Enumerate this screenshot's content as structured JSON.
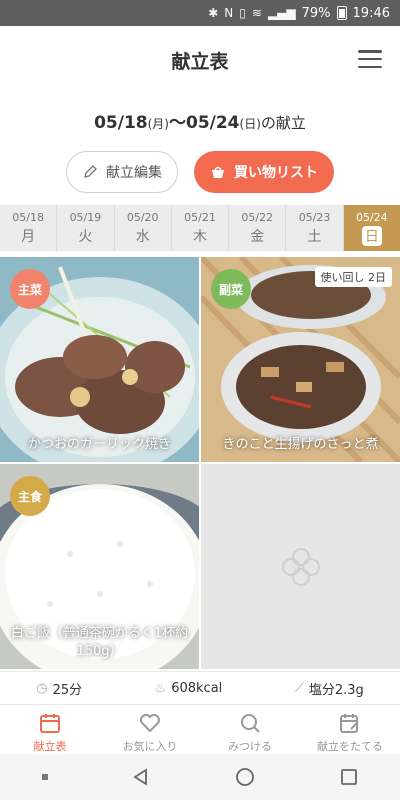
{
  "status": {
    "battery": "79%",
    "time": "19:46"
  },
  "header": {
    "title": "献立表"
  },
  "week": {
    "start": "05/18",
    "start_day": "(月)",
    "sep": "〜",
    "end": "05/24",
    "end_day": "(日)",
    "suffix": "の献立"
  },
  "actions": {
    "edit_label": "献立編集",
    "shopping_label": "買い物リスト"
  },
  "days": [
    {
      "date": "05/18",
      "weekday": "月"
    },
    {
      "date": "05/19",
      "weekday": "火"
    },
    {
      "date": "05/20",
      "weekday": "水"
    },
    {
      "date": "05/21",
      "weekday": "木"
    },
    {
      "date": "05/22",
      "weekday": "金"
    },
    {
      "date": "05/23",
      "weekday": "土"
    },
    {
      "date": "05/24",
      "weekday": "日"
    }
  ],
  "recipes": [
    {
      "tag": "主菜",
      "name": "かつおのガーリック焼き",
      "tag_color": "#f0836b"
    },
    {
      "tag": "副菜",
      "name": "きのこと生揚げのさっと煮",
      "badge": "使い回し 2日",
      "tag_color": "#7fba5a"
    },
    {
      "tag": "主食",
      "name": "白ご飯（普通茶碗かるく1杯約150g）",
      "tag_color": "#d4a94a"
    }
  ],
  "summary": {
    "time": "25分",
    "calories": "608kcal",
    "salt": "塩分2.3g"
  },
  "nav": {
    "menu": "献立表",
    "favorites": "お気に入り",
    "find": "みつける",
    "plan": "献立をたてる"
  },
  "colors": {
    "accent": "#f26a4f",
    "active_day": "#c49a52"
  }
}
